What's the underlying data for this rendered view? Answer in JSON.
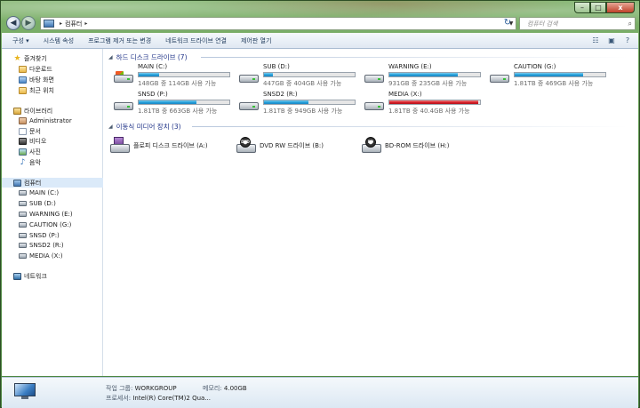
{
  "window": {
    "controls": {
      "minimize": "–",
      "maximize": "□",
      "close": "x"
    }
  },
  "navbar": {
    "back_icon": "back-arrow-icon",
    "forward_icon": "forward-arrow-icon",
    "address": {
      "location": "컴퓨터",
      "separator": "▸"
    },
    "refresh_icon": "refresh-icon",
    "search": {
      "placeholder": "컴퓨터 검색",
      "icon": "search-icon"
    }
  },
  "toolbar": {
    "items": [
      {
        "label": "구성 ▾"
      },
      {
        "label": "시스템 속성"
      },
      {
        "label": "프로그램 제거 또는 변경"
      },
      {
        "label": "네트워크 드라이브 연결"
      },
      {
        "label": "제어판 열기"
      }
    ],
    "right_icons": [
      "view-options-icon",
      "preview-pane-icon",
      "help-icon"
    ]
  },
  "sidebar": {
    "favorites": {
      "title": "즐겨찾기",
      "items": [
        {
          "label": "다운로드",
          "icon": "downloads-folder-icon"
        },
        {
          "label": "바탕 화면",
          "icon": "desktop-icon"
        },
        {
          "label": "최근 위치",
          "icon": "recent-places-icon"
        }
      ]
    },
    "libraries": {
      "title": "라이브러리",
      "items": [
        {
          "label": "Administrator",
          "icon": "user-folder-icon"
        },
        {
          "label": "문서",
          "icon": "documents-icon"
        },
        {
          "label": "비디오",
          "icon": "videos-icon"
        },
        {
          "label": "사진",
          "icon": "pictures-icon"
        },
        {
          "label": "음악",
          "icon": "music-icon"
        }
      ]
    },
    "computer": {
      "title": "컴퓨터",
      "items": [
        {
          "label": "MAIN (C:)"
        },
        {
          "label": "SUB (D:)"
        },
        {
          "label": "WARNING (E:)"
        },
        {
          "label": "CAUTION (G:)"
        },
        {
          "label": "SNSD (P:)"
        },
        {
          "label": "SNSD2 (R:)"
        },
        {
          "label": "MEDIA (X:)"
        }
      ]
    },
    "network": {
      "title": "네트워크"
    }
  },
  "main": {
    "hard_disks": {
      "header": "하드 디스크 드라이브 (7)",
      "drives": [
        {
          "name": "MAIN (C:)",
          "free": "148GB 중 114GB 사용 가능",
          "used_fraction": 0.23,
          "color": "#26a0da",
          "system": true
        },
        {
          "name": "SUB (D:)",
          "free": "447GB 중 404GB 사용 가능",
          "used_fraction": 0.1,
          "color": "#26a0da"
        },
        {
          "name": "WARNING (E:)",
          "free": "931GB 중 235GB 사용 가능",
          "used_fraction": 0.75,
          "color": "#26a0da"
        },
        {
          "name": "CAUTION (G:)",
          "free": "1.81TB 중 469GB 사용 가능",
          "used_fraction": 0.75,
          "color": "#26a0da"
        },
        {
          "name": "SNSD (P:)",
          "free": "1.81TB 중 663GB 사용 가능",
          "used_fraction": 0.64,
          "color": "#26a0da"
        },
        {
          "name": "SNSD2 (R:)",
          "free": "1.81TB 중 949GB 사용 가능",
          "used_fraction": 0.49,
          "color": "#26a0da"
        },
        {
          "name": "MEDIA (X:)",
          "free": "1.81TB 중 40.4GB 사용 가능",
          "used_fraction": 0.98,
          "color": "#d8202a"
        }
      ]
    },
    "removable": {
      "header": "이동식 미디어 장치 (3)",
      "devices": [
        {
          "name": "플로피 디스크 드라이브 (A:)",
          "icon": "floppy-drive-icon",
          "badge": ""
        },
        {
          "name": "DVD RW 드라이브 (B:)",
          "icon": "dvd-drive-icon",
          "badge": "DVD"
        },
        {
          "name": "BD-ROM 드라이브 (H:)",
          "icon": "bd-drive-icon",
          "badge": "BD"
        }
      ]
    }
  },
  "details": {
    "workgroup_label": "작업 그룹:",
    "workgroup_value": "WORKGROUP",
    "memory_label": "메모리:",
    "memory_value": "4.00GB",
    "processor_label": "프로세서:",
    "processor_value": "Intel(R) Core(TM)2 Qua..."
  }
}
